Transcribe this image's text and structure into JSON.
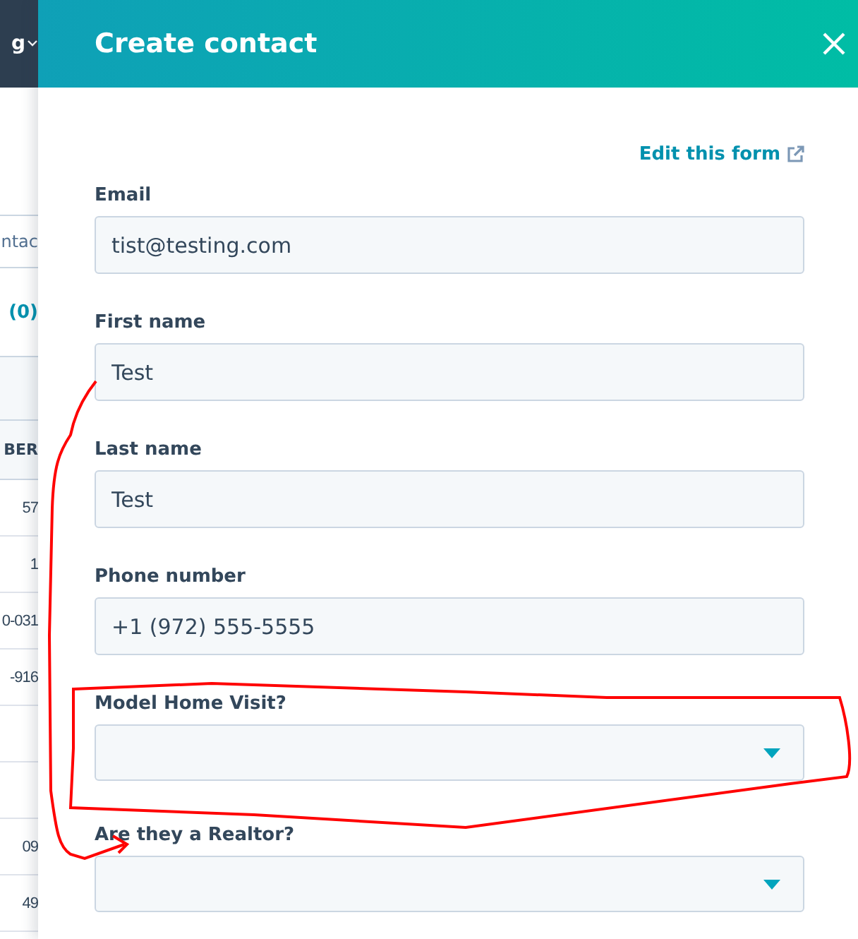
{
  "background_page": {
    "top_bar_text": "g",
    "tab_text": "ntac",
    "count": "(0)",
    "column_header": "BER",
    "rows": [
      {
        "cell": "57"
      },
      {
        "cell": "1"
      },
      {
        "cell": "0-031"
      },
      {
        "cell": "-916"
      },
      {},
      {},
      {
        "cell": "09"
      },
      {
        "cell": "49"
      }
    ]
  },
  "panel": {
    "title": "Create contact",
    "edit_link": "Edit this form",
    "fields": [
      {
        "kind": "text",
        "label": "Email",
        "value": "tist@testing.com"
      },
      {
        "kind": "text",
        "label": "First name",
        "value": "Test"
      },
      {
        "kind": "text",
        "label": "Last name",
        "value": "Test"
      },
      {
        "kind": "text",
        "label": "Phone number",
        "value": "+1 (972) 555-5555"
      },
      {
        "kind": "select",
        "label": "Model Home Visit?"
      },
      {
        "kind": "select",
        "label": "Are they a Realtor?"
      }
    ]
  }
}
